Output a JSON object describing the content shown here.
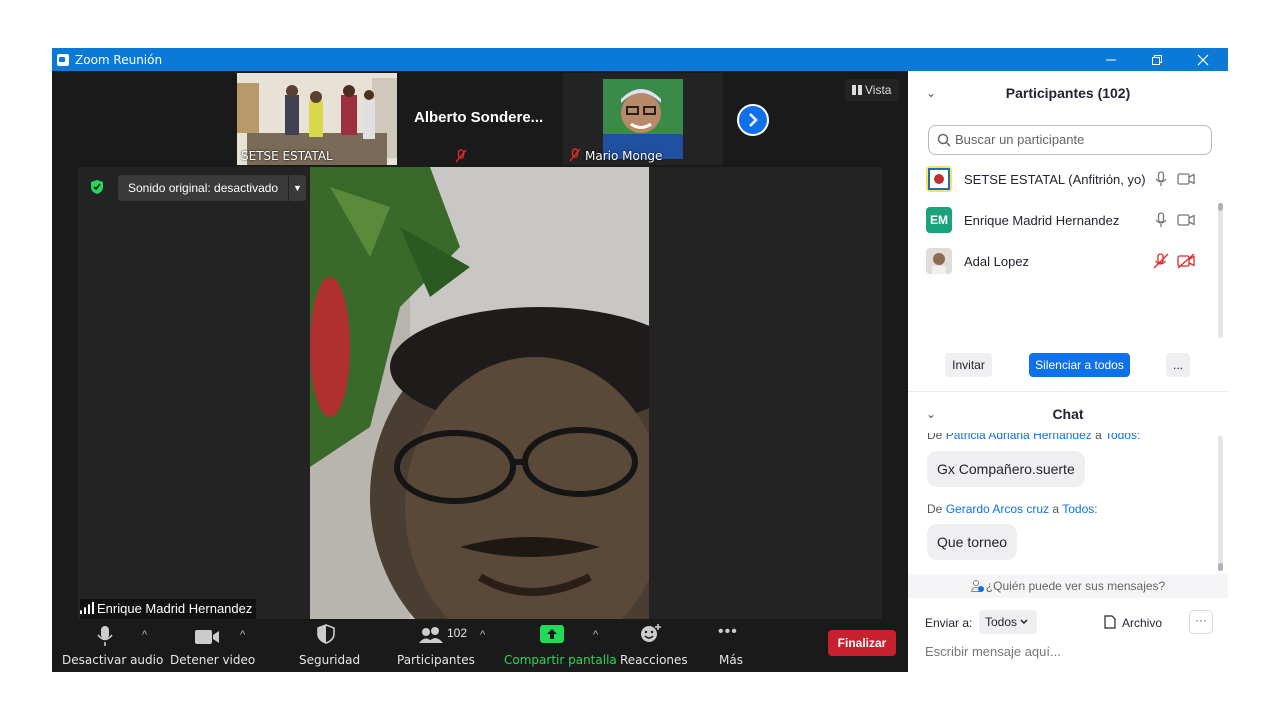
{
  "window": {
    "title": "Zoom Reunión"
  },
  "strip": {
    "tiles": [
      {
        "name": "SETSE ESTATAL"
      },
      {
        "name": "Alberto  Sondere..."
      },
      {
        "name": "Mario  Monge"
      }
    ],
    "view_label": "Vista"
  },
  "main_video": {
    "sound_label": "Sonido original: desactivado",
    "speaker_name": "Enrique Madrid Hernandez"
  },
  "toolbar": {
    "mute": "Desactivar audio",
    "video": "Detener video",
    "security": "Seguridad",
    "participants": "Participantes",
    "participants_count": "102",
    "share": "Compartir pantalla",
    "reactions": "Reacciones",
    "more": "Más",
    "end": "Finalizar"
  },
  "participants_panel": {
    "title": "Participantes (102)",
    "search_placeholder": "Buscar un participante",
    "items": [
      {
        "name": "SETSE ESTATAL (Anfitrión, yo)",
        "muted": false
      },
      {
        "name": "Enrique Madrid Hernandez",
        "initials": "EM",
        "muted": false
      },
      {
        "name": "Adal Lopez",
        "muted": true
      }
    ],
    "invite": "Invitar",
    "mute_all": "Silenciar a todos",
    "more": "..."
  },
  "chat_panel": {
    "title": "Chat",
    "messages": [
      {
        "prefix": "De",
        "from": "Patricia Adriana Hernandez",
        "to_word": "a",
        "to": "Todos:",
        "text": "Gx Compañero.suerte"
      },
      {
        "prefix": "De",
        "from": "Gerardo Arcos cruz",
        "to_word": "a",
        "to": "Todos:",
        "text": "Que torneo"
      }
    ],
    "who_can_see": "¿Quién puede ver sus mensajes?",
    "send_to_label": "Enviar a:",
    "send_to_value": "Todos",
    "file_label": "Archivo",
    "input_placeholder": "Escribir mensaje aquí..."
  },
  "colors": {
    "accent": "#0e71eb",
    "titlebar": "#0b7ad6",
    "end_button": "#c7202e",
    "share_green": "#23d959",
    "muted_red": "#e02828"
  }
}
